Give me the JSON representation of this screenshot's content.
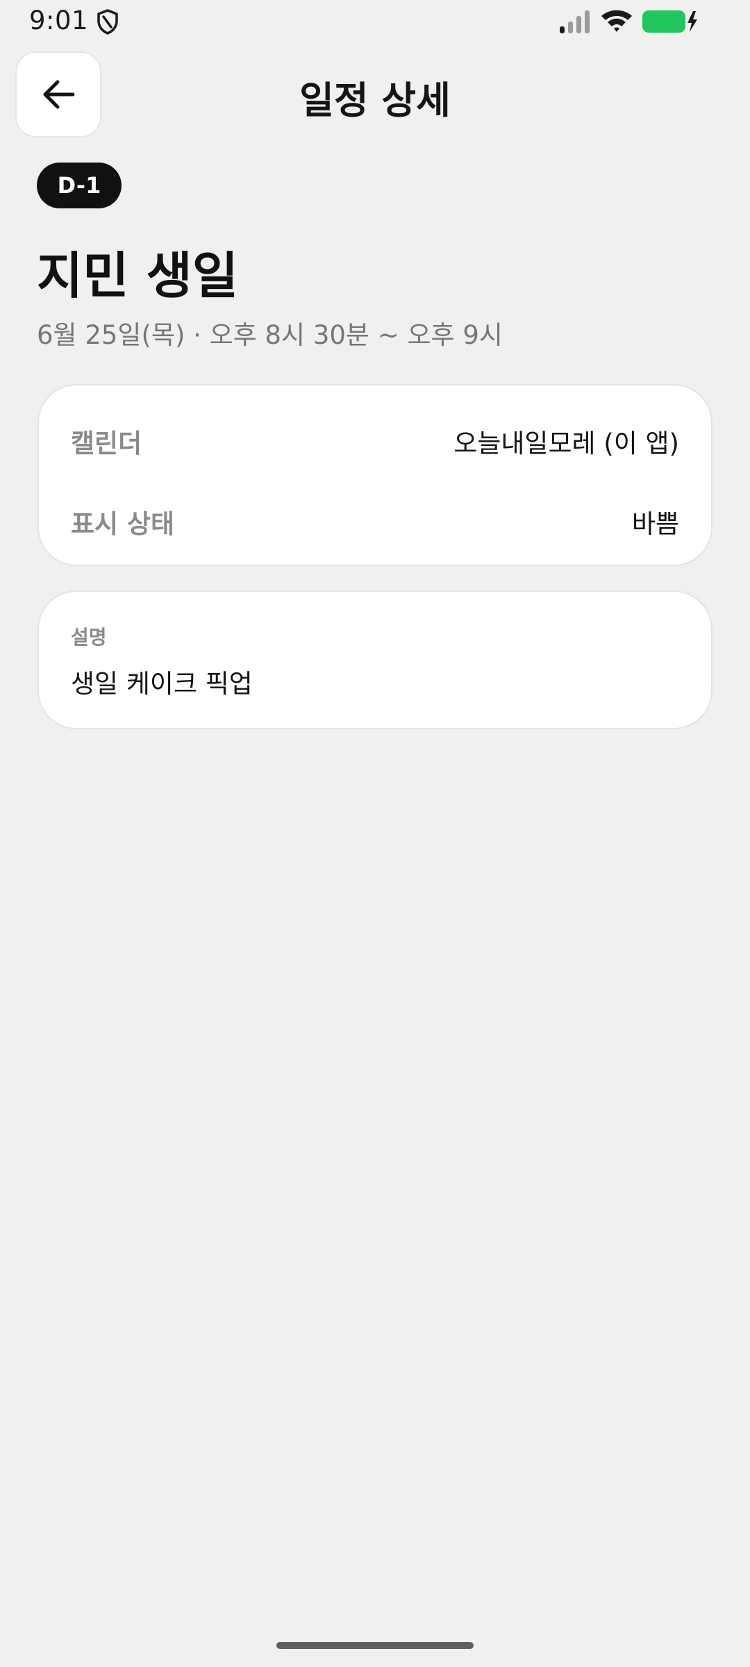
{
  "status_bar": {
    "time": "9:01",
    "icons": [
      "shield-icon",
      "signal-icon",
      "wifi-icon",
      "battery-charging-icon"
    ],
    "battery_color": "#22c55e"
  },
  "header": {
    "title": "일정 상세",
    "back_icon": "arrow-left-icon"
  },
  "event": {
    "dday": "D-1",
    "title": "지민 생일",
    "datetime": "6월 25일(목) · 오후 8시 30분 ~ 오후 9시"
  },
  "details": {
    "calendar_label": "캘린더",
    "calendar_value": "오늘내일모레 (이 앱)",
    "status_label": "표시 상태",
    "status_value": "바쁨"
  },
  "description": {
    "label": "설명",
    "text": "생일 케이크 픽업"
  }
}
